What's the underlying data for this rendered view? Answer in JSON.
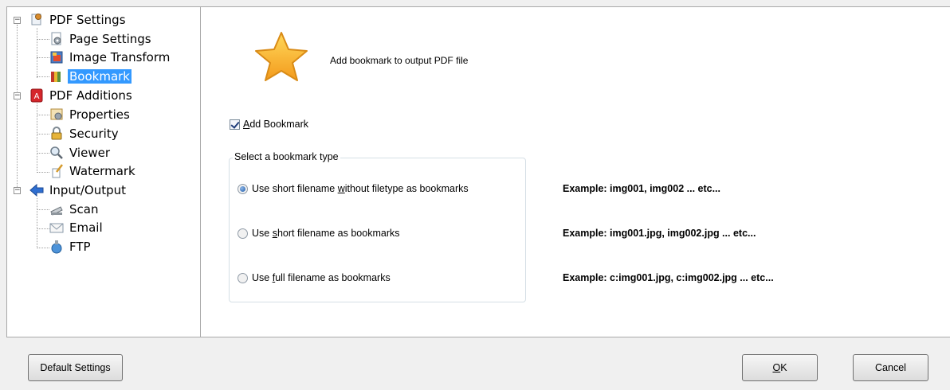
{
  "tree": {
    "pdf_settings": "PDF Settings",
    "page_settings": "Page Settings",
    "image_transform": "Image Transform",
    "bookmark": "Bookmark",
    "pdf_additions": "PDF Additions",
    "properties": "Properties",
    "security": "Security",
    "viewer": "Viewer",
    "watermark": "Watermark",
    "input_output": "Input/Output",
    "scan": "Scan",
    "email": "Email",
    "ftp": "FTP"
  },
  "header": {
    "description": "Add bookmark to output PDF file"
  },
  "options": {
    "add_bookmark_prefix": "",
    "add_bookmark_mnemonic": "A",
    "add_bookmark_rest": "dd Bookmark",
    "add_bookmark_checked": true,
    "group_title": "Select a bookmark type",
    "radio1_a": "Use short filename ",
    "radio1_m": "w",
    "radio1_b": "ithout filetype as bookmarks",
    "radio2_a": "Use ",
    "radio2_m": "s",
    "radio2_b": "hort filename as bookmarks",
    "radio3_a": "Use ",
    "radio3_m": "f",
    "radio3_b": "ull filename as bookmarks",
    "selected": 1,
    "example1": "Example:  img001, img002 ... etc...",
    "example2": "Example:  img001.jpg, img002.jpg ... etc...",
    "example3": "Example:  c:img001.jpg, c:img002.jpg ... etc..."
  },
  "buttons": {
    "default_settings": "Default Settings",
    "ok_m": "O",
    "ok_rest": "K",
    "cancel": "Cancel"
  },
  "colors": {
    "selection": "#3399ff",
    "star": "#f7a824"
  }
}
